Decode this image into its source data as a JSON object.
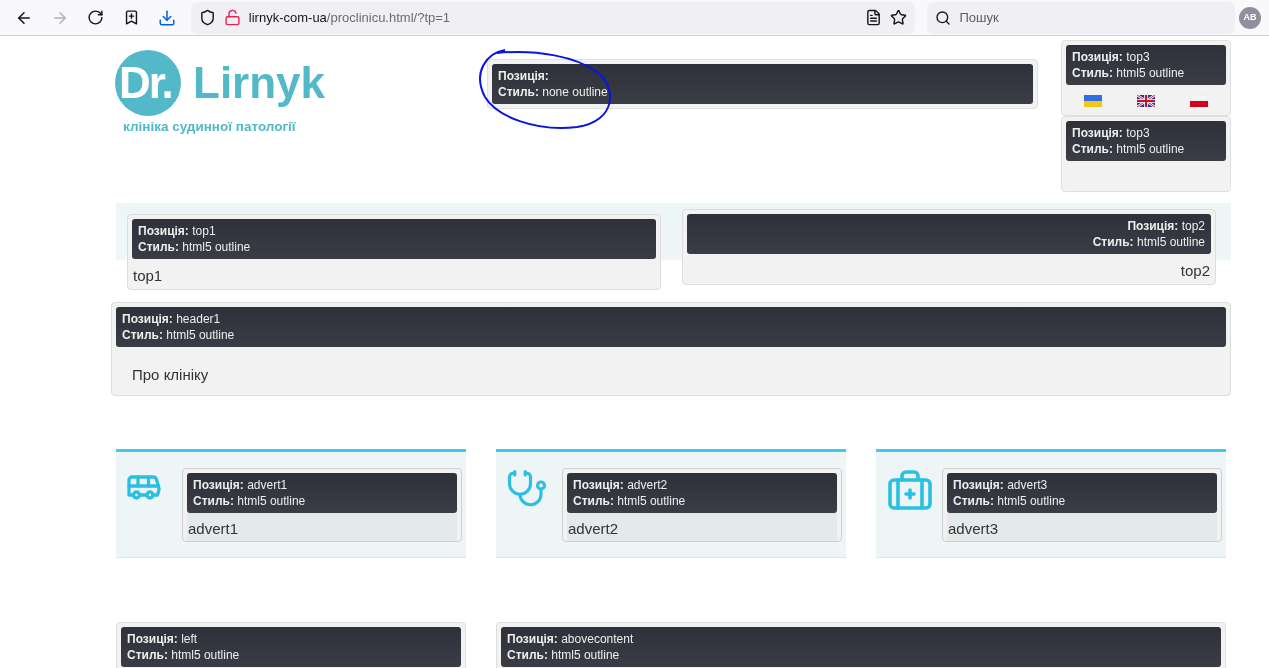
{
  "browser": {
    "forward_disabled": true,
    "url_host": "lirnyk-com-ua",
    "url_path": "/proclinicu.html/?tp=1",
    "search_placeholder": "Пошук",
    "profile": "AB"
  },
  "logo": {
    "mark": "Dr.",
    "name": "Lirnyk",
    "tagline": "клініка судинної патології"
  },
  "center_module": {
    "lines": [
      "**Позиція:**",
      "**Стиль:** none outline"
    ]
  },
  "side_modules": [
    {
      "lines": [
        "**Позиція:** top3",
        "**Стиль:** html5 outline"
      ],
      "flags": [
        {
          "kind": "ua"
        },
        {
          "kind": "gb"
        },
        {
          "kind": "pl"
        }
      ]
    },
    {
      "lines": [
        "**Позиція:** top3",
        "**Стиль:** html5 outline"
      ]
    }
  ],
  "top_modules": [
    {
      "kind": "start",
      "lines": [
        "**Позиція:** top1",
        "**Стиль:** html5 outline"
      ],
      "content": "top1"
    },
    {
      "kind": "end",
      "lines": [
        "**Позиція:** top2",
        "**Стиль:** html5 outline"
      ],
      "content": "top2"
    }
  ],
  "header_module": {
    "lines": [
      "**Позиція:** header1",
      "**Стиль:** html5 outline"
    ],
    "content": "Про клініку"
  },
  "adverts": [
    {
      "kind": "bus",
      "lines": [
        "**Позиція:** advert1",
        "**Стиль:** html5 outline"
      ],
      "content": "advert1"
    },
    {
      "kind": "stethoscope",
      "lines": [
        "**Позиція:** advert2",
        "**Стиль:** html5 outline"
      ],
      "content": "advert2"
    },
    {
      "kind": "medkit",
      "lines": [
        "**Позиція:** advert3",
        "**Стиль:** html5 outline"
      ],
      "content": "advert3"
    }
  ],
  "bottom_modules": [
    {
      "lines": [
        "**Позиція:** left",
        "**Стиль:** html5 outline"
      ]
    },
    {
      "lines": [
        "**Позиція:** abovecontent",
        "**Стиль:** html5 outline"
      ]
    }
  ]
}
